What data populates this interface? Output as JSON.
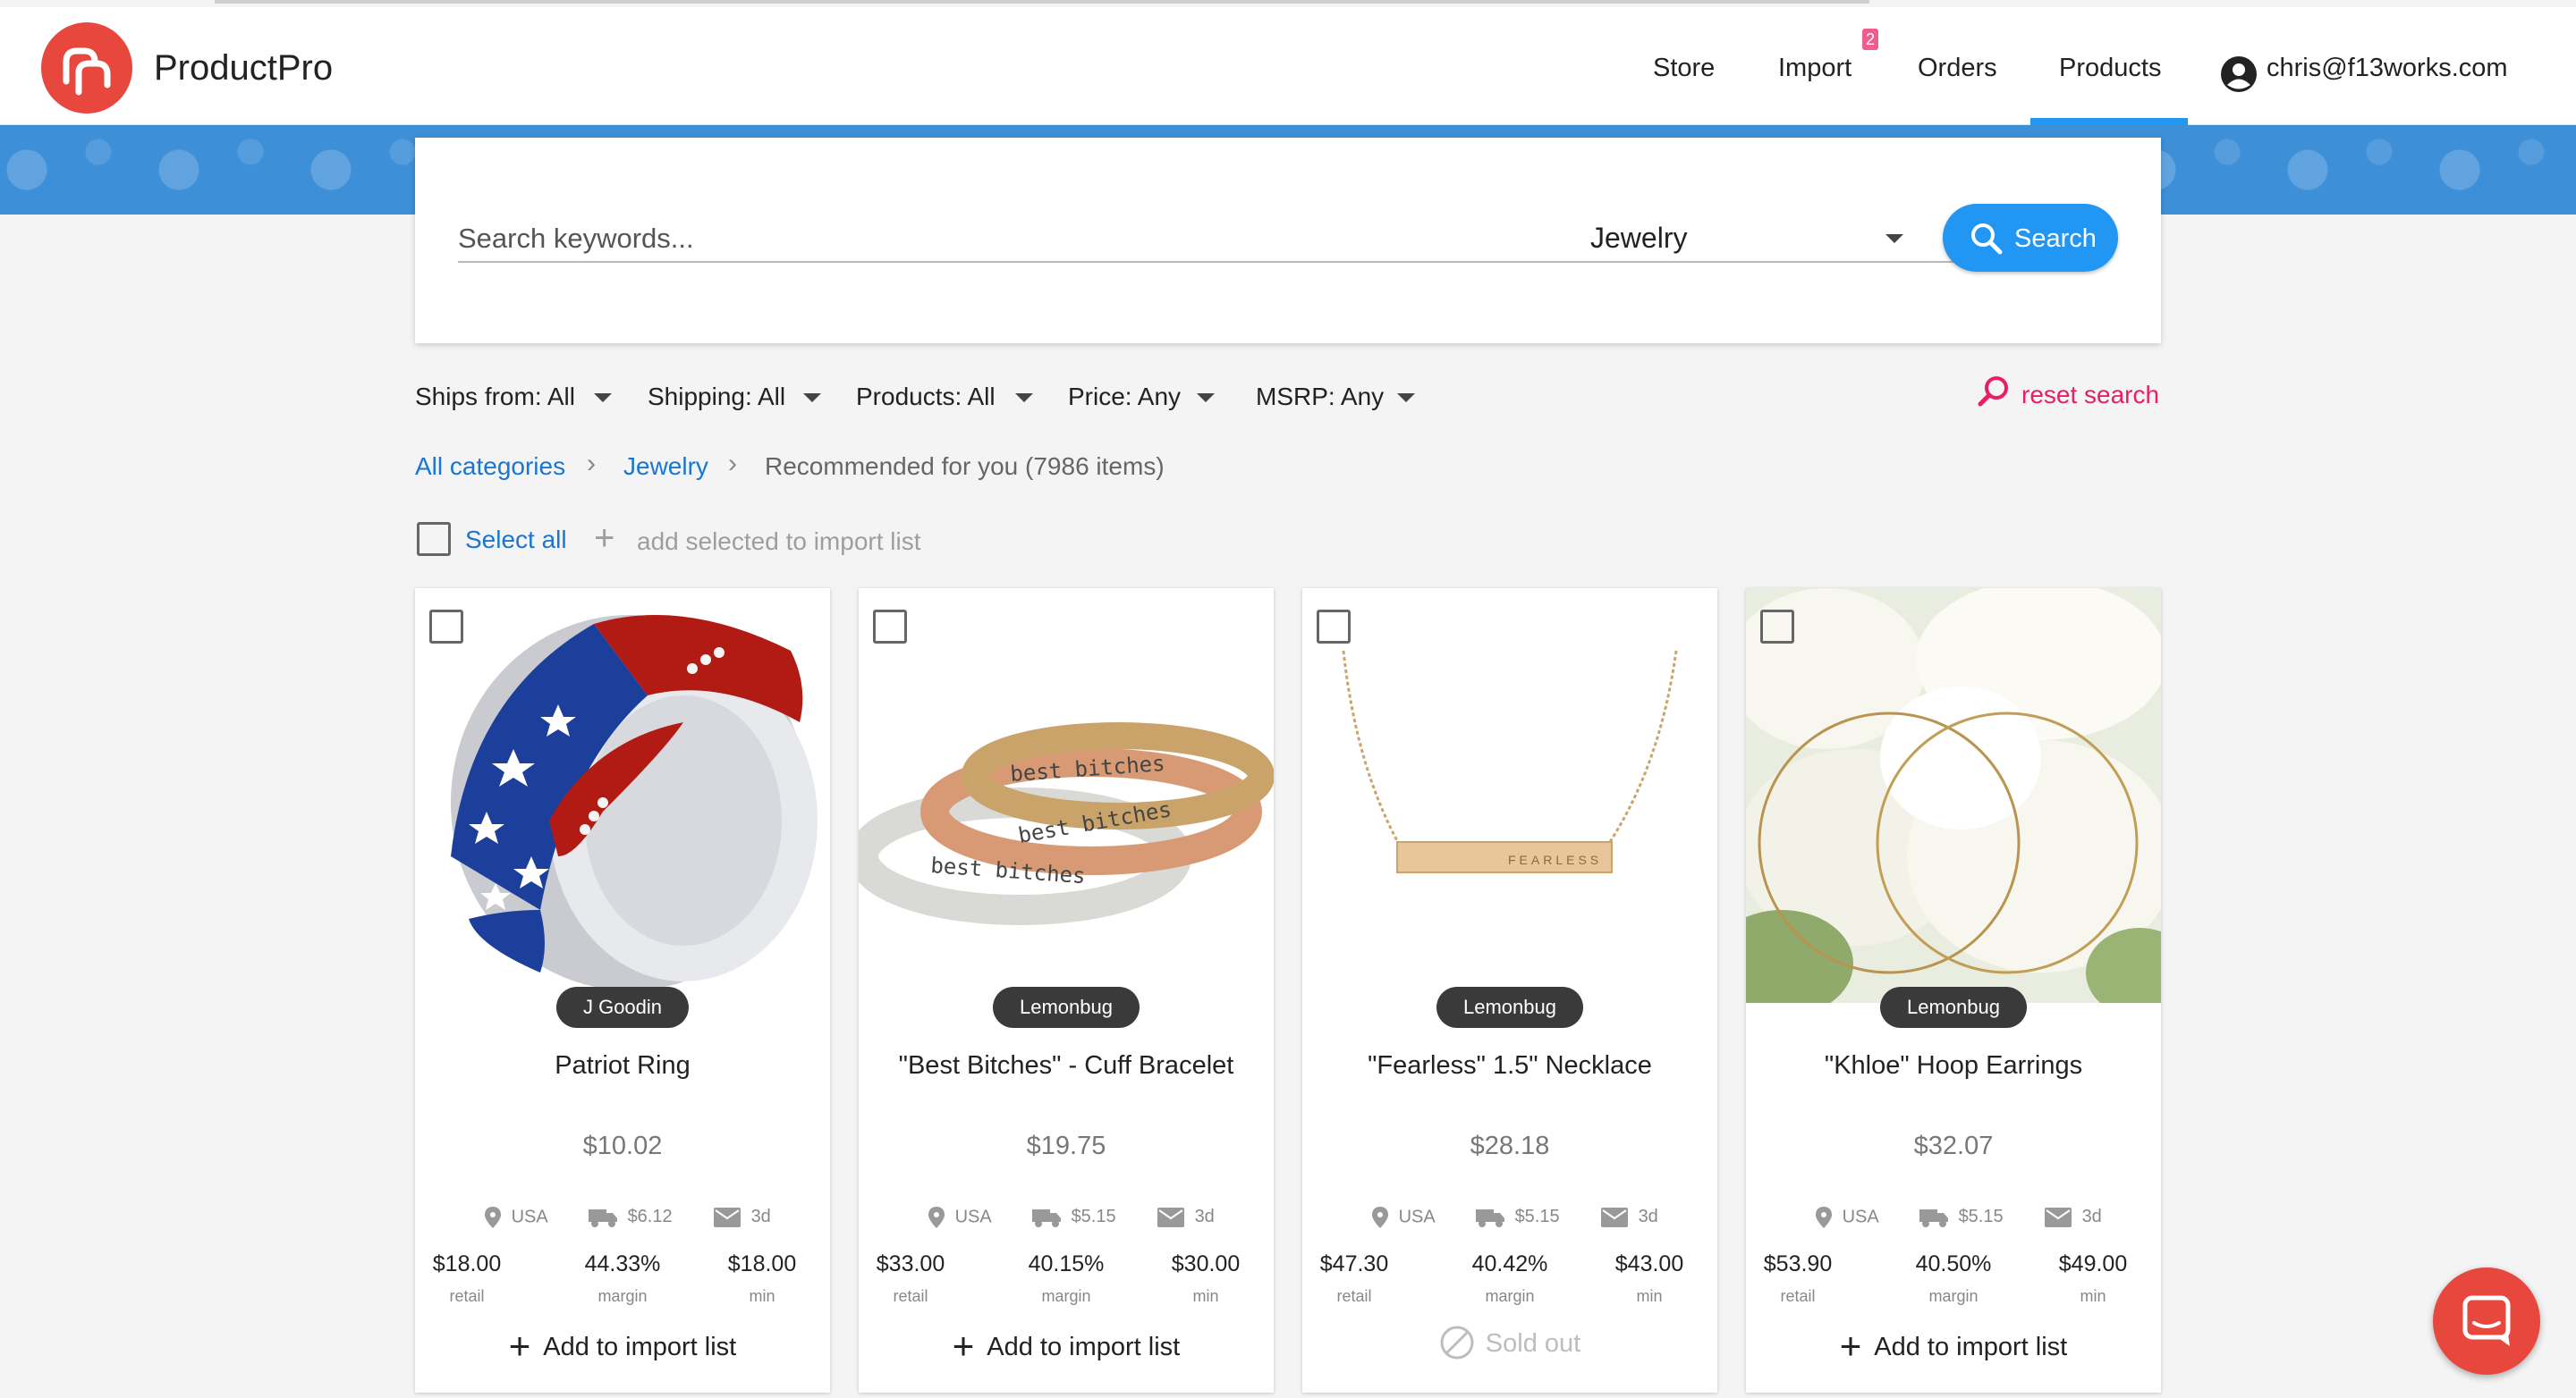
{
  "app": {
    "brand": "ProductPro"
  },
  "nav": {
    "items": [
      {
        "label": "Store"
      },
      {
        "label": "Import",
        "badge": "2"
      },
      {
        "label": "Orders"
      },
      {
        "label": "Products",
        "active": true
      }
    ],
    "account_email": "chris@f13works.com"
  },
  "search": {
    "placeholder": "Search keywords...",
    "value": "",
    "category": "Jewelry",
    "button_label": "Search"
  },
  "filters": [
    {
      "label": "Ships from: All"
    },
    {
      "label": "Shipping: All"
    },
    {
      "label": "Products: All"
    },
    {
      "label": "Price: Any"
    },
    {
      "label": "MSRP: Any"
    }
  ],
  "reset_label": "reset search",
  "breadcrumb": {
    "items": [
      "All categories",
      "Jewelry"
    ],
    "current": "Recommended for you (7986 items)"
  },
  "selection": {
    "select_all_label": "Select all",
    "add_selected_label": "add selected to import list"
  },
  "products": [
    {
      "vendor": "J Goodin",
      "title": "Patriot Ring",
      "price": "$10.02",
      "ships_from": "USA",
      "shipping": "$6.12",
      "delivery": "3d",
      "retail": "$18.00",
      "margin": "44.33%",
      "min": "$18.00",
      "action": "Add to import list",
      "image": "patriot-ring"
    },
    {
      "vendor": "Lemonbug",
      "title": "\"Best Bitches\" - Cuff Bracelet",
      "price": "$19.75",
      "ships_from": "USA",
      "shipping": "$5.15",
      "delivery": "3d",
      "retail": "$33.00",
      "margin": "40.15%",
      "min": "$30.00",
      "action": "Add to import list",
      "image": "cuff-bracelets",
      "engraving": "best bitches"
    },
    {
      "vendor": "Lemonbug",
      "title": "\"Fearless\" 1.5\" Necklace",
      "price": "$28.18",
      "ships_from": "USA",
      "shipping": "$5.15",
      "delivery": "3d",
      "retail": "$47.30",
      "margin": "40.42%",
      "min": "$43.00",
      "action": "Sold out",
      "image": "bar-necklace",
      "engraving": "FEARLESS"
    },
    {
      "vendor": "Lemonbug",
      "title": "\"Khloe\" Hoop Earrings",
      "price": "$32.07",
      "ships_from": "USA",
      "shipping": "$5.15",
      "delivery": "3d",
      "retail": "$53.90",
      "margin": "40.50%",
      "min": "$49.00",
      "action": "Add to import list",
      "image": "hoop-earrings"
    }
  ],
  "stat_labels": {
    "retail": "retail",
    "margin": "margin",
    "min": "min"
  },
  "colors": {
    "primary": "#2196f3",
    "brand": "#e8473e",
    "reset": "#e91e63",
    "badge": "#ef5c8f"
  }
}
